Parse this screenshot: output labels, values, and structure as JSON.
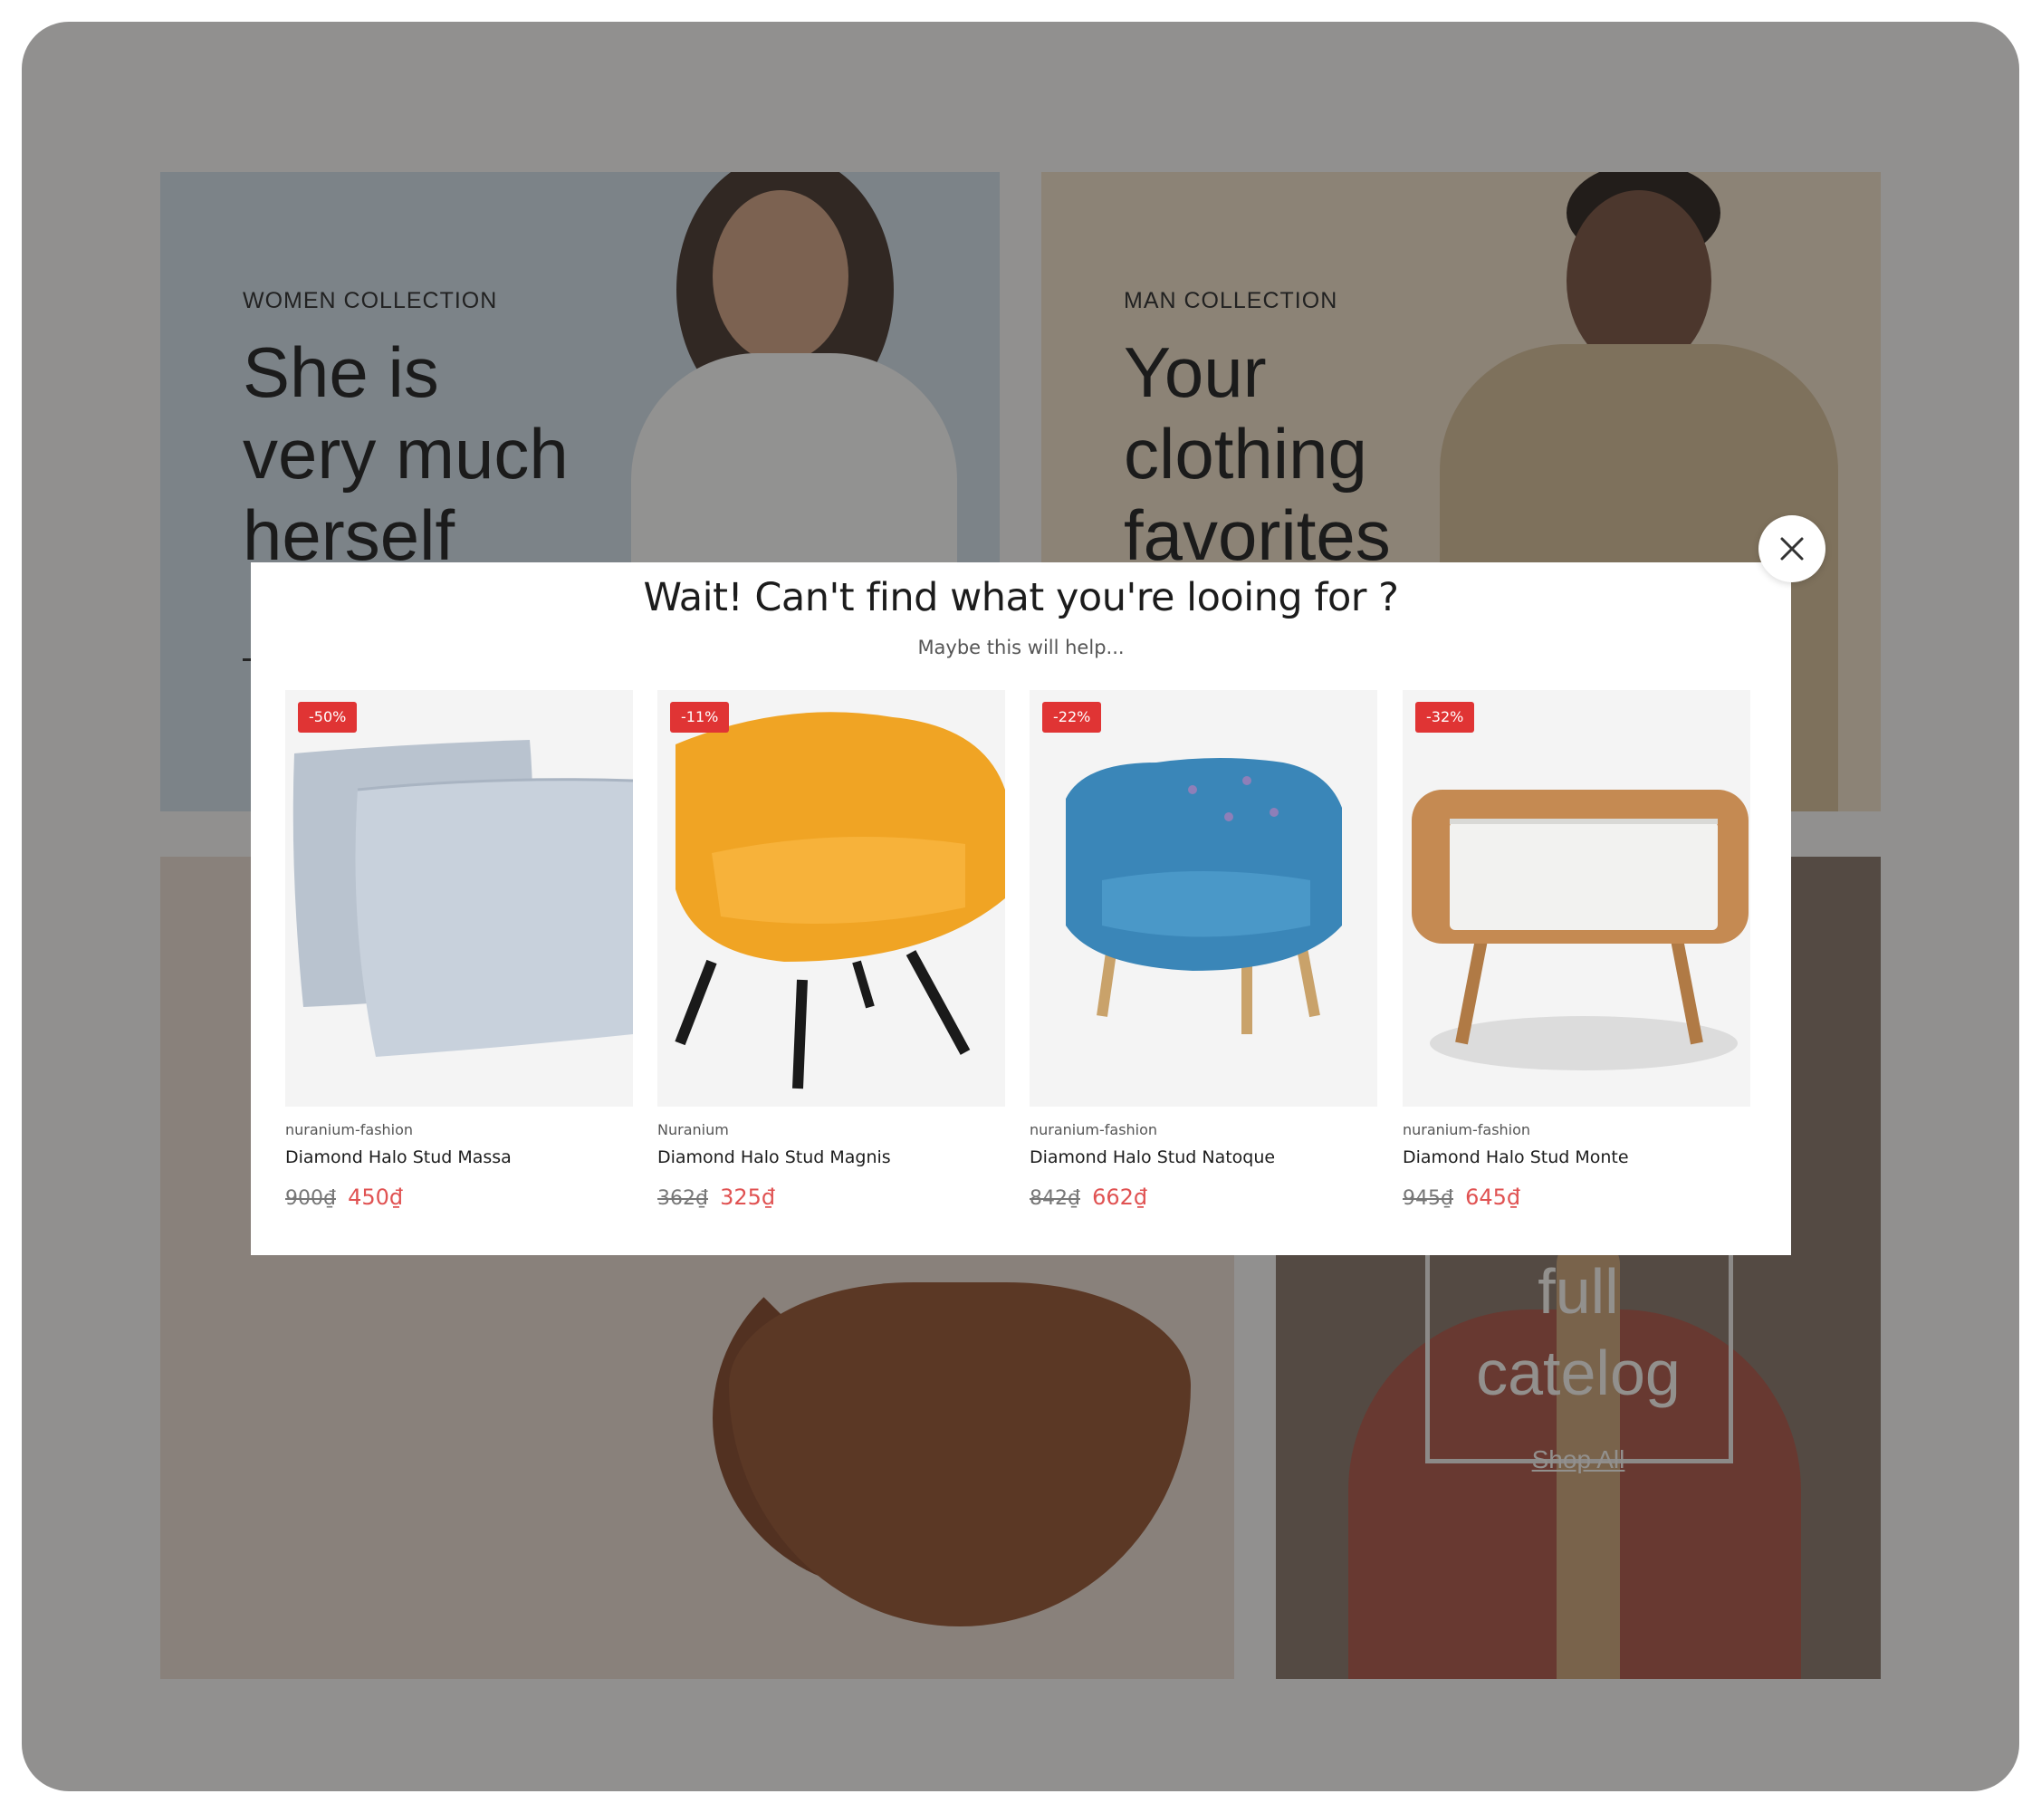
{
  "background": {
    "women": {
      "eyebrow": "WOMEN COLLECTION",
      "heading": "She is very much herself"
    },
    "man": {
      "eyebrow": "MAN COLLECTION",
      "heading": "Your clothing favorites"
    },
    "catalog": {
      "word1": "full",
      "word2": "catelog",
      "link": "Shop All"
    }
  },
  "modal": {
    "title": "Wait! Can't find what you're looing for ?",
    "subtitle": "Maybe this will help...",
    "close_icon": "close-icon",
    "products": [
      {
        "badge": "-50%",
        "vendor": "nuranium-fashion",
        "name": "Diamond Halo Stud Massa",
        "old_price": "900₫",
        "price": "450₫",
        "image": "pillows"
      },
      {
        "badge": "-11%",
        "vendor": "Nuranium",
        "name": "Diamond Halo Stud Magnis",
        "old_price": "362₫",
        "price": "325₫",
        "image": "yellow-armchair"
      },
      {
        "badge": "-22%",
        "vendor": "nuranium-fashion",
        "name": "Diamond Halo Stud Natoque",
        "old_price": "842₫",
        "price": "662₫",
        "image": "blue-armchair"
      },
      {
        "badge": "-32%",
        "vendor": "nuranium-fashion",
        "name": "Diamond Halo Stud Monte",
        "old_price": "945₫",
        "price": "645₫",
        "image": "nightstand"
      }
    ]
  },
  "colors": {
    "badge": "#e03434",
    "sale_price": "#e05252",
    "overlay": "rgba(40,40,40,0.48)"
  }
}
